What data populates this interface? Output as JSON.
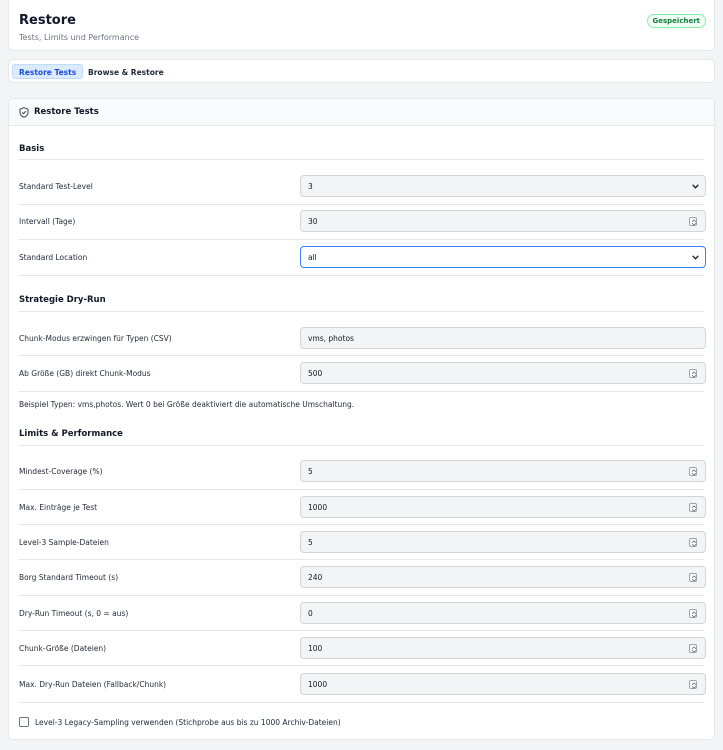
{
  "header": {
    "title": "Restore",
    "subtitle": "Tests, Limits und Performance",
    "status_badge": "Gespeichert",
    "badge_color": "#15803d"
  },
  "tabs": [
    {
      "label": "Restore Tests",
      "active": true
    },
    {
      "label": "Browse & Restore",
      "active": false
    }
  ],
  "panel": {
    "title": "Restore Tests",
    "icon": "shield-icon"
  },
  "sections": {
    "basis": {
      "title": "Basis",
      "fields": [
        {
          "label": "Standard Test-Level",
          "value": "3",
          "control": "select"
        },
        {
          "label": "Intervall (Tage)",
          "value": "30",
          "control": "number"
        },
        {
          "label": "Standard Location",
          "value": "all",
          "control": "select"
        }
      ]
    },
    "dryrun": {
      "title": "Strategie Dry-Run",
      "fields": [
        {
          "label": "Chunk-Modus erzwingen für Typen (CSV)",
          "value": "vms, photos",
          "control": "text"
        },
        {
          "label": "Ab Größe (GB) direkt Chunk-Modus",
          "value": "500",
          "control": "number"
        }
      ],
      "help": "Beispiel Typen: vms,photos. Wert 0 bei Größe deaktiviert die automatische Umschaltung."
    },
    "limits": {
      "title": "Limits & Performance",
      "fields": [
        {
          "label": "Mindest-Coverage (%)",
          "value": "5",
          "control": "number"
        },
        {
          "label": "Max. Einträge je Test",
          "value": "1000",
          "control": "number"
        },
        {
          "label": "Level-3 Sample-Dateien",
          "value": "5",
          "control": "number"
        },
        {
          "label": "Borg Standard Timeout (s)",
          "value": "240",
          "control": "number"
        },
        {
          "label": "Dry-Run Timeout (s, 0 = aus)",
          "value": "0",
          "control": "number"
        },
        {
          "label": "Chunk-Größe (Dateien)",
          "value": "100",
          "control": "number"
        },
        {
          "label": "Max. Dry-Run Dateien (Fallback/Chunk)",
          "value": "1000",
          "control": "number"
        }
      ]
    }
  },
  "legacy_sampling": {
    "label": "Level-3 Legacy-Sampling verwenden (Stichprobe aus bis zu 1000 Archiv-Dateien)",
    "checked": false
  },
  "colors": {
    "accent": "#3b82f6",
    "tab_active_bg": "#dbeafe",
    "page_bg": "#f3f4f6"
  }
}
